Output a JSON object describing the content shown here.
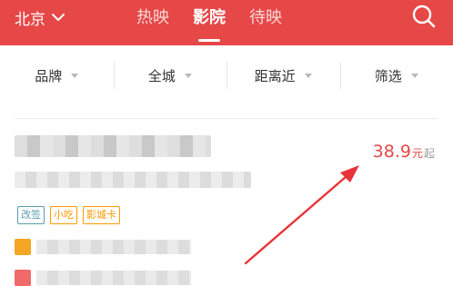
{
  "header": {
    "city": "北京",
    "tabs": [
      {
        "label": "热映",
        "active": false
      },
      {
        "label": "影院",
        "active": true
      },
      {
        "label": "待映",
        "active": false
      }
    ],
    "bg_color": "#e54847"
  },
  "filters": [
    {
      "label": "品牌"
    },
    {
      "label": "全城"
    },
    {
      "label": "距离近"
    },
    {
      "label": "筛选"
    }
  ],
  "cinema": {
    "tags": [
      "改签",
      "小吃",
      "影城卡"
    ],
    "price": {
      "value": "38.9",
      "unit": "元",
      "suffix": "起"
    }
  },
  "colors": {
    "accent": "#e54847",
    "annotation_arrow": "#e8343a",
    "tag_blue": "#589daf",
    "tag_orange": "#ff9900"
  },
  "icons": {
    "city_dropdown": "chevron-down-icon",
    "search": "search-icon"
  }
}
